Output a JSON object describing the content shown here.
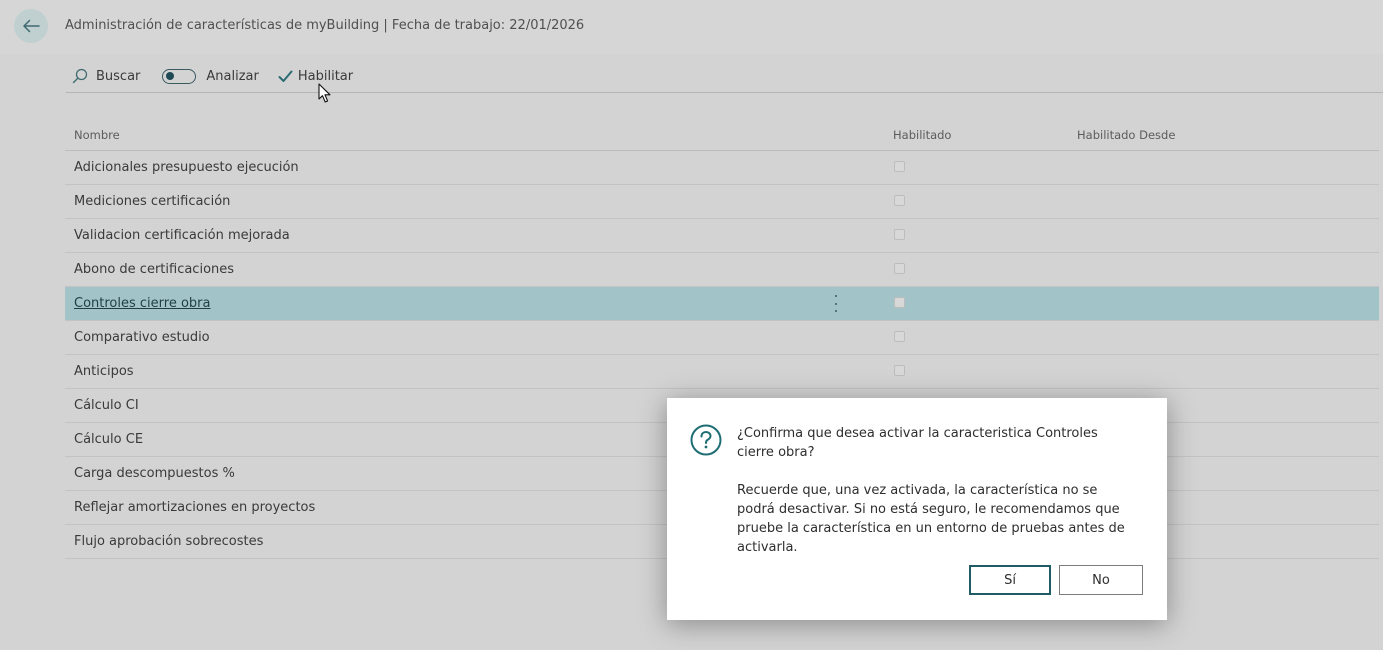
{
  "header": {
    "title": "Administración de características de myBuilding | Fecha de trabajo: 22/01/2026"
  },
  "toolbar": {
    "search_label": "Buscar",
    "analyze_label": "Analizar",
    "analyze_toggle_on": false,
    "enable_label": "Habilitar"
  },
  "table": {
    "columns": {
      "name": "Nombre",
      "enabled": "Habilitado",
      "enabled_since": "Habilitado Desde"
    },
    "rows": [
      {
        "name": "Adicionales presupuesto ejecución",
        "enabled": false
      },
      {
        "name": "Mediciones certificación",
        "enabled": false
      },
      {
        "name": "Validacion certificación mejorada",
        "enabled": false
      },
      {
        "name": "Abono de certificaciones",
        "enabled": false
      },
      {
        "name": "Controles cierre obra",
        "enabled": false,
        "selected": true
      },
      {
        "name": "Comparativo estudio",
        "enabled": false
      },
      {
        "name": "Anticipos",
        "enabled": false
      },
      {
        "name": "Cálculo CI",
        "enabled": false
      },
      {
        "name": "Cálculo CE",
        "enabled": false
      },
      {
        "name": "Carga descompuestos %",
        "enabled": false
      },
      {
        "name": "Reflejar amortizaciones en proyectos",
        "enabled": false
      },
      {
        "name": "Flujo aprobación sobrecostes",
        "enabled": false
      }
    ]
  },
  "dialog": {
    "question": "¿Confirma que desea activar la caracteristica Controles cierre obra?",
    "detail": "Recuerde que, una vez activada, la característica no se podrá desactivar. Si no está seguro, le recomendamos que pruebe la característica en un entorno de pruebas antes de activarla.",
    "yes_label": "Sí",
    "no_label": "No"
  },
  "icons": {
    "back": "arrow-left-icon",
    "search": "search-icon",
    "enable": "checkmark-icon",
    "question": "question-circle-icon",
    "row_menu": "more-vertical-icon"
  },
  "colors": {
    "accent": "#1f5c66",
    "selected_row": "#a2c4c8",
    "background": "#d6d6d6"
  }
}
